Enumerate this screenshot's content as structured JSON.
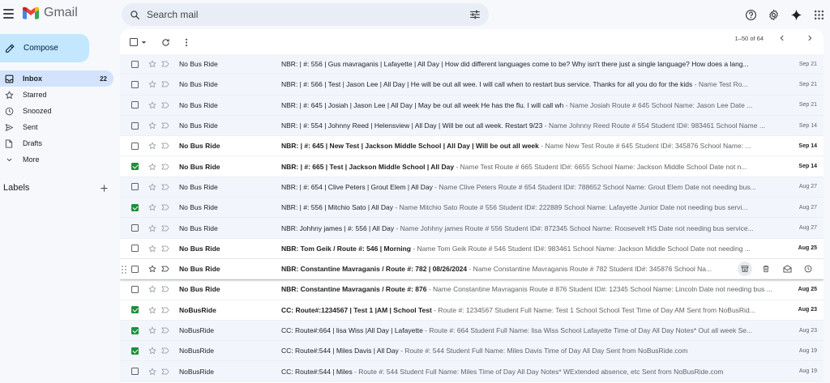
{
  "app": {
    "name": "Gmail"
  },
  "search": {
    "placeholder": "Search mail"
  },
  "compose": {
    "label": "Compose"
  },
  "sidebar": {
    "items": [
      {
        "label": "Inbox",
        "count": "22",
        "icon": "inbox-icon",
        "active": true
      },
      {
        "label": "Starred",
        "count": "",
        "icon": "star-icon"
      },
      {
        "label": "Snoozed",
        "count": "",
        "icon": "clock-icon"
      },
      {
        "label": "Sent",
        "count": "",
        "icon": "send-icon"
      },
      {
        "label": "Drafts",
        "count": "",
        "icon": "draft-icon"
      },
      {
        "label": "More",
        "count": "",
        "icon": "chevron-down-icon"
      }
    ],
    "labels_heading": "Labels"
  },
  "pager": {
    "range": "1–50 of 64"
  },
  "emails": [
    {
      "sender": "No Bus Ride",
      "subject": "NBR: | #: 556 | Gus mavraganis | Lafayette | All Day | How did different languages come to be? Why isn't there just a single language? How does a lang...",
      "snippet": "",
      "date": "Sep 21",
      "unread": false,
      "checked": false
    },
    {
      "sender": "No Bus Ride",
      "subject": "NBR: | #: 566 | Test | Jason Lee | All Day | He will be out all wee. I will call when to restart bus service. Thanks for all you do for the kids",
      "snippet": " - Name Test Ro...",
      "date": "Sep 21",
      "unread": false,
      "checked": false
    },
    {
      "sender": "No Bus Ride",
      "subject": "NBR: | #: 645 | Josiah | Jason Lee | All Day | May be out all week He has the flu. I will call wh",
      "snippet": " - Name Josiah Route # 645 School Name: Jason Lee Date ...",
      "date": "Sep 21",
      "unread": false,
      "checked": false
    },
    {
      "sender": "No Bus Ride",
      "subject": "NBR: | #: 554 | Johnny Reed | Helensview | All Day | Will be out all week. Restart 9/23",
      "snippet": " - Name Johnny Reed Route # 554 Student ID#: 983461 School Name ...",
      "date": "Sep 14",
      "unread": false,
      "checked": false
    },
    {
      "sender": "No Bus Ride",
      "subject": "NBR: | #: 645 | New Test | Jackson Middle School | All Day | Will be out all week",
      "snippet": " - Name New Test Route # 645 Student ID#: 345876 School Name: ...",
      "date": "Sep 14",
      "unread": true,
      "checked": false
    },
    {
      "sender": "No Bus Ride",
      "subject": "NBR: | #: 665 | Test | Jackson Middle School | All Day",
      "snippet": " - Name Test Route # 665 Student ID#: 6655 School Name: Jackson Middle School Date not n...",
      "date": "Sep 14",
      "unread": true,
      "checked": true
    },
    {
      "sender": "No Bus Ride",
      "subject": "NBR: | #: 654 | Clive Peters | Grout Elem | All Day",
      "snippet": " - Name Clive Peters Route # 654 Student ID#: 788652 School Name: Grout Elem Date not needing bus...",
      "date": "Aug 27",
      "unread": false,
      "checked": false
    },
    {
      "sender": "No Bus Ride",
      "subject": "NBR: | #: 556 | Mitchio Sato | All Day",
      "snippet": " - Name Mitchio Sato Route # 556 Student ID#: 222889 School Name: Lafayette Junior Date not needing bus servi...",
      "date": "Aug 27",
      "unread": false,
      "checked": true
    },
    {
      "sender": "No Bus Ride",
      "subject": "NBR: Johhny james | #: 556 | All Day",
      "snippet": " - Name Johhny james Route # 556 Student ID#: 872345 School Name: Roosevelt HS Date not needing bus service...",
      "date": "Aug 27",
      "unread": false,
      "checked": false
    },
    {
      "sender": "No Bus Ride",
      "subject": "NBR: Tom Geik / Route #: 546 | Morning",
      "snippet": " - Name Tom Geik Route # 546 Student ID#: 983461 School Name: Jackson Middle School Date not needing ...",
      "date": "Aug 25",
      "unread": true,
      "checked": false
    },
    {
      "sender": "No Bus Ride",
      "subject": "NBR: Constantine Mavraganis / Route #: 782 | 08/26/2024",
      "snippet": " - Name Constantine Mavraganis Route # 782 Student ID#: 345876 School Na...",
      "date": "",
      "unread": true,
      "checked": false,
      "hover": true
    },
    {
      "sender": "No Bus Ride",
      "subject": "NBR: Constantine Mavraganis / Route #: 876",
      "snippet": " - Name Constantine Mavraganis Route # 876 Student ID#: 12345 School Name: Lincoln Date not needing bus ...",
      "date": "Aug 25",
      "unread": true,
      "checked": false
    },
    {
      "sender": "NoBusRide",
      "subject": "CC: Route#:1234567 | Test 1 |AM | School Test",
      "snippet": " - Route #: 1234567 Student Full Name: Test 1 School School Test Time of Day AM Sent from NoBusRid...",
      "date": "Aug 23",
      "unread": true,
      "checked": true
    },
    {
      "sender": "NoBusRide",
      "subject": "CC: Route#:664 | lisa Wiss |All Day | Lafayette",
      "snippet": " - Route #: 664 Student Full Name: lisa Wiss School Lafayette Time of Day All Day Notes* Out all week Se...",
      "date": "Aug 23",
      "unread": false,
      "checked": true
    },
    {
      "sender": "NoBusRide",
      "subject": "CC: Route#:544 | Miles Davis | All Day",
      "snippet": " - Route #: 544 Student Full Name: Miles Davis Time of Day All Day Sent from NoBusRide.com",
      "date": "Aug 19",
      "unread": false,
      "checked": true
    },
    {
      "sender": "NoBusRide",
      "subject": "CC: Route#:544 | Miles",
      "snippet": " - Route #: 544 Student Full Name: Miles Time of Day All Day Notes* WExtended absence, etc Sent from NoBusRide.com",
      "date": "Aug 19",
      "unread": false,
      "checked": false
    }
  ],
  "colors": {
    "accent": "#1a73e8",
    "compose_bg": "#c2e7ff",
    "active_nav": "#d3e3fd",
    "checked": "#1e8e3e"
  }
}
